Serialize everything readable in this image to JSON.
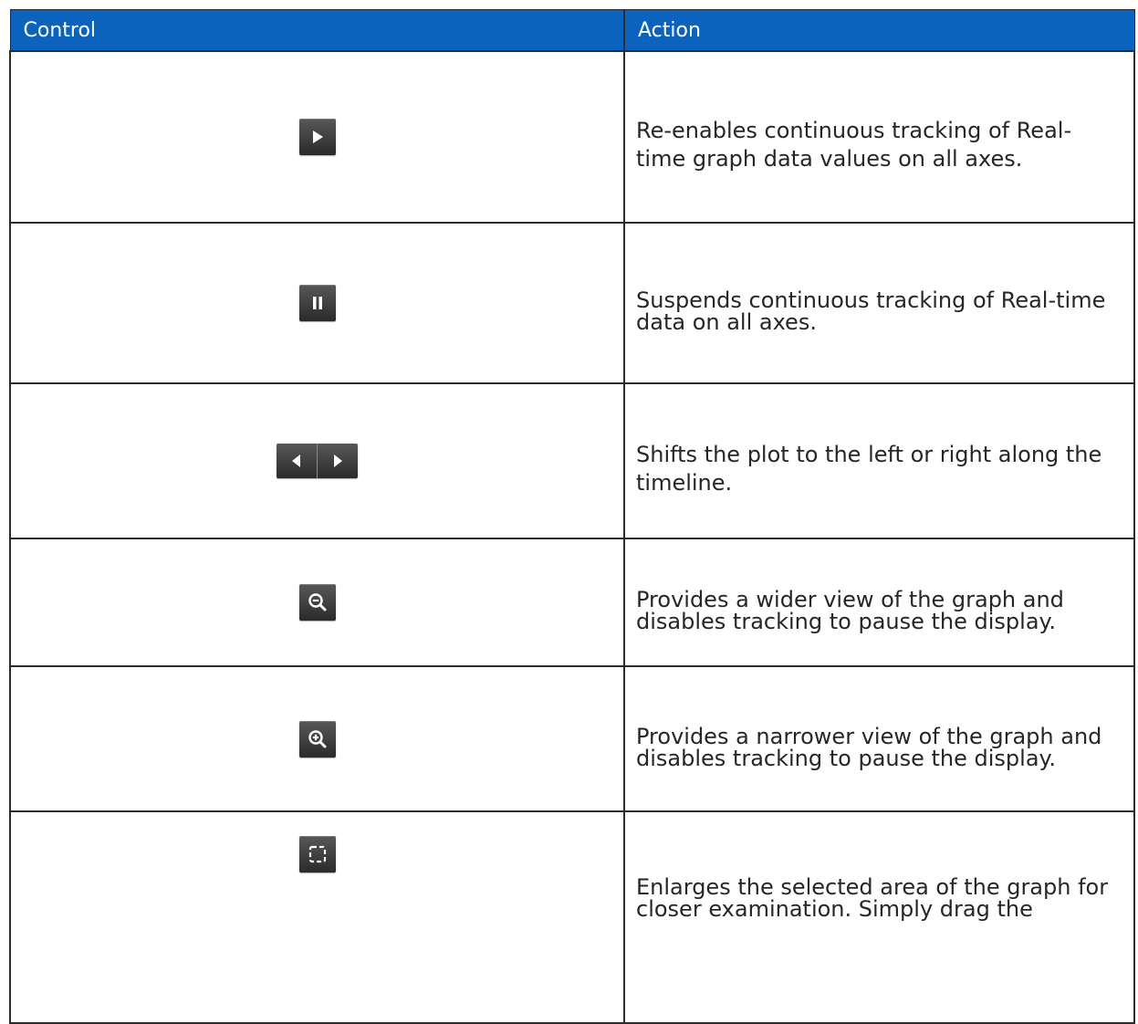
{
  "header": {
    "control": "Control",
    "action": "Action"
  },
  "rows": [
    {
      "icon": "play-icon",
      "description": "Re-enables continuous tracking of Real-time graph data values on all axes."
    },
    {
      "icon": "pause-icon",
      "description": "Suspends continuous tracking of Real-time data on all axes."
    },
    {
      "icon": "left-right-arrows-icon",
      "description": "Shifts the plot to the left or right along the timeline."
    },
    {
      "icon": "zoom-out-icon",
      "description": "Provides a wider view of the graph and disables tracking to pause the display."
    },
    {
      "icon": "zoom-in-icon",
      "description": "Provides a narrower view of the graph and disables tracking to pause the display."
    },
    {
      "icon": "zoom-area-icon",
      "description": "Enlarges the selected area of the graph for closer examination. Simply drag the"
    }
  ],
  "colors": {
    "header_bg": "#0b63bd",
    "header_text": "#ffffff",
    "button_bg": "#3a3a3a",
    "border": "#2b2b2b"
  }
}
